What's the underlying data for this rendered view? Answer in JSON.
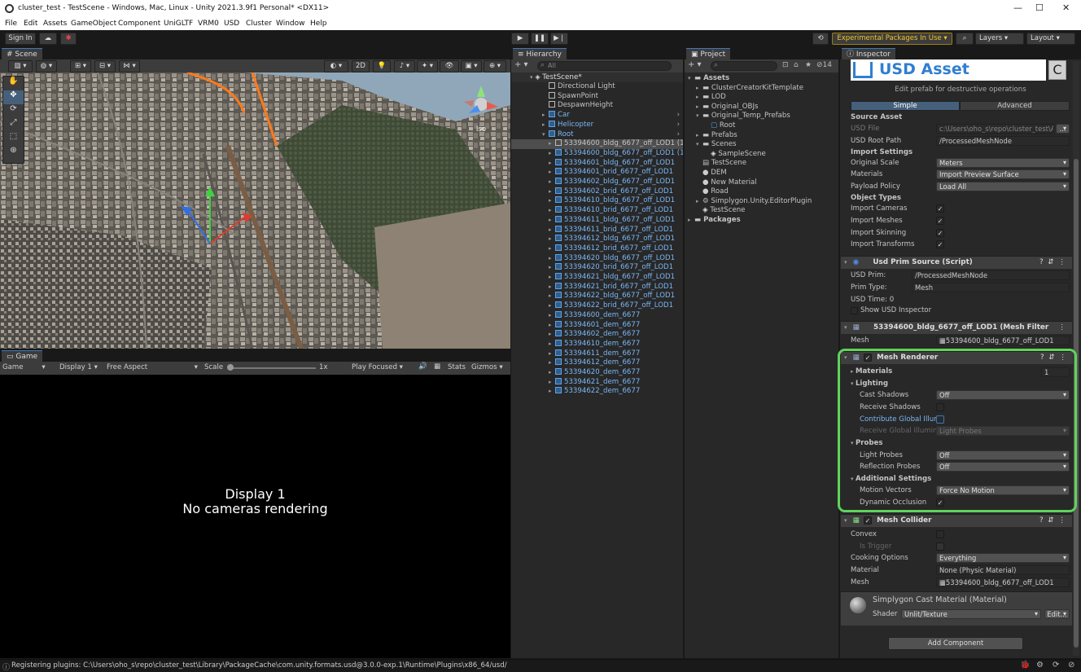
{
  "window": {
    "title": "cluster_test - TestScene - Windows, Mac, Linux - Unity 2021.3.9f1 Personal* <DX11>",
    "min": "—",
    "max": "☐",
    "close": "✕"
  },
  "menu": [
    "File",
    "Edit",
    "Assets",
    "GameObject",
    "Component",
    "UniGLTF",
    "VRM0",
    "USD",
    "Cluster",
    "Window",
    "Help"
  ],
  "toolbar": {
    "sign_in": "Sign In",
    "experimental": "Experimental Packages In Use ▾",
    "layers": "Layers",
    "layout": "Layout"
  },
  "scene": {
    "tab": "Scene",
    "mode_2d": "2D",
    "persp": "Iso"
  },
  "game": {
    "tab": "Game",
    "display_dd": "Game",
    "display": "Display 1",
    "aspect": "Free Aspect",
    "scale_label": "Scale",
    "scale_value": "1x",
    "play_focused": "Play Focused",
    "stats": "Stats",
    "gizmos": "Gizmos",
    "msg1": "Display 1",
    "msg2": "No cameras rendering"
  },
  "hierarchy": {
    "tab": "Hierarchy",
    "search": "All",
    "scene": "TestScene*",
    "items": [
      {
        "label": "Directional Light",
        "depth": 1,
        "blue": false,
        "exp": ""
      },
      {
        "label": "SpawnPoint",
        "depth": 1,
        "blue": false,
        "exp": ""
      },
      {
        "label": "DespawnHeight",
        "depth": 1,
        "blue": false,
        "exp": ""
      },
      {
        "label": "Car",
        "depth": 1,
        "blue": true,
        "exp": "▸"
      },
      {
        "label": "Helicopter",
        "depth": 1,
        "blue": true,
        "exp": "▸"
      },
      {
        "label": "Root",
        "depth": 1,
        "blue": true,
        "exp": "▾"
      },
      {
        "label": "53394600_bldg_6677_off_LOD1 (1)",
        "depth": 2,
        "blue": false,
        "exp": "▸",
        "sel": true
      },
      {
        "label": "53394600_bldg_6677_off_LOD1 (1)",
        "depth": 2,
        "blue": true,
        "exp": "▸"
      },
      {
        "label": "53394601_bldg_6677_off_LOD1",
        "depth": 2,
        "blue": true,
        "exp": "▸"
      },
      {
        "label": "53394601_brid_6677_off_LOD1",
        "depth": 2,
        "blue": true,
        "exp": "▸"
      },
      {
        "label": "53394602_bldg_6677_off_LOD1",
        "depth": 2,
        "blue": true,
        "exp": "▸"
      },
      {
        "label": "53394602_brid_6677_off_LOD1",
        "depth": 2,
        "blue": true,
        "exp": "▸"
      },
      {
        "label": "53394610_bldg_6677_off_LOD1",
        "depth": 2,
        "blue": true,
        "exp": "▸"
      },
      {
        "label": "53394610_brid_6677_off_LOD1",
        "depth": 2,
        "blue": true,
        "exp": "▸"
      },
      {
        "label": "53394611_bldg_6677_off_LOD1",
        "depth": 2,
        "blue": true,
        "exp": "▸"
      },
      {
        "label": "53394611_brid_6677_off_LOD1",
        "depth": 2,
        "blue": true,
        "exp": "▸"
      },
      {
        "label": "53394612_bldg_6677_off_LOD1",
        "depth": 2,
        "blue": true,
        "exp": "▸"
      },
      {
        "label": "53394612_brid_6677_off_LOD1",
        "depth": 2,
        "blue": true,
        "exp": "▸"
      },
      {
        "label": "53394620_bldg_6677_off_LOD1",
        "depth": 2,
        "blue": true,
        "exp": "▸"
      },
      {
        "label": "53394620_brid_6677_off_LOD1",
        "depth": 2,
        "blue": true,
        "exp": "▸"
      },
      {
        "label": "53394621_bldg_6677_off_LOD1",
        "depth": 2,
        "blue": true,
        "exp": "▸"
      },
      {
        "label": "53394621_brid_6677_off_LOD1",
        "depth": 2,
        "blue": true,
        "exp": "▸"
      },
      {
        "label": "53394622_bldg_6677_off_LOD1",
        "depth": 2,
        "blue": true,
        "exp": "▸"
      },
      {
        "label": "53394622_brid_6677_off_LOD1",
        "depth": 2,
        "blue": true,
        "exp": "▸"
      },
      {
        "label": "53394600_dem_6677",
        "depth": 2,
        "blue": true,
        "exp": "▸"
      },
      {
        "label": "53394601_dem_6677",
        "depth": 2,
        "blue": true,
        "exp": "▸"
      },
      {
        "label": "53394602_dem_6677",
        "depth": 2,
        "blue": true,
        "exp": "▸"
      },
      {
        "label": "53394610_dem_6677",
        "depth": 2,
        "blue": true,
        "exp": "▸"
      },
      {
        "label": "53394611_dem_6677",
        "depth": 2,
        "blue": true,
        "exp": "▸"
      },
      {
        "label": "53394612_dem_6677",
        "depth": 2,
        "blue": true,
        "exp": "▸"
      },
      {
        "label": "53394620_dem_6677",
        "depth": 2,
        "blue": true,
        "exp": "▸"
      },
      {
        "label": "53394621_dem_6677",
        "depth": 2,
        "blue": true,
        "exp": "▸"
      },
      {
        "label": "53394622_dem_6677",
        "depth": 2,
        "blue": true,
        "exp": "▸"
      }
    ]
  },
  "project": {
    "tab": "Project",
    "count": "14",
    "items": [
      {
        "label": "Assets",
        "depth": 0,
        "exp": "▾",
        "icon": "folder",
        "bold": true
      },
      {
        "label": "ClusterCreatorKitTemplate",
        "depth": 1,
        "exp": "▸",
        "icon": "folder"
      },
      {
        "label": "LOD",
        "depth": 1,
        "exp": "▸",
        "icon": "folder"
      },
      {
        "label": "Original_OBJs",
        "depth": 1,
        "exp": "▸",
        "icon": "folder"
      },
      {
        "label": "Original_Temp_Prefabs",
        "depth": 1,
        "exp": "▾",
        "icon": "folder"
      },
      {
        "label": "Root",
        "depth": 2,
        "exp": "",
        "icon": "cube"
      },
      {
        "label": "Prefabs",
        "depth": 1,
        "exp": "▸",
        "icon": "folder"
      },
      {
        "label": "Scenes",
        "depth": 1,
        "exp": "▾",
        "icon": "folder"
      },
      {
        "label": "SampleScene",
        "depth": 2,
        "exp": "",
        "icon": "unity"
      },
      {
        "label": "TestScene",
        "depth": 1,
        "exp": "",
        "icon": "file"
      },
      {
        "label": "DEM",
        "depth": 1,
        "exp": "",
        "icon": "sphere"
      },
      {
        "label": "New Material",
        "depth": 1,
        "exp": "",
        "icon": "sphere"
      },
      {
        "label": "Road",
        "depth": 1,
        "exp": "",
        "icon": "sphere"
      },
      {
        "label": "Simplygon.Unity.EditorPlugin",
        "depth": 1,
        "exp": "▸",
        "icon": "asm"
      },
      {
        "label": "TestScene",
        "depth": 1,
        "exp": "",
        "icon": "unity"
      },
      {
        "label": "Packages",
        "depth": 0,
        "exp": "▸",
        "icon": "folder",
        "bold": true
      }
    ]
  },
  "inspector": {
    "tab": "Inspector",
    "usd_title": "USD Asset",
    "subtitle": "Edit prefab for destructive operations",
    "tab_simple": "Simple",
    "tab_advanced": "Advanced",
    "source_asset": "Source Asset",
    "usd_file_label": "USD File",
    "usd_file": "c:\\Users\\oho_s\\repo\\cluster_test\\As",
    "usd_root_label": "USD Root Path",
    "usd_root": "/ProcessedMeshNode",
    "import_settings": "Import Settings",
    "orig_scale_label": "Original Scale",
    "orig_scale": "Meters",
    "materials_label": "Materials",
    "materials": "Import Preview Surface",
    "payload_label": "Payload Policy",
    "payload": "Load All",
    "object_types": "Object Types",
    "imp_cameras": "Import Cameras",
    "imp_meshes": "Import Meshes",
    "imp_skinning": "Import Skinning",
    "imp_transforms": "Import Transforms",
    "prim_source": {
      "title": "Usd Prim Source (Script)",
      "prim_label": "USD Prim:",
      "prim": "/ProcessedMeshNode",
      "type_label": "Prim Type:",
      "type": "Mesh",
      "time": "USD Time: 0",
      "show": "Show USD Inspector"
    },
    "mesh_filter": {
      "title": "53394600_bldg_6677_off_LOD1 (Mesh Filter",
      "mesh_label": "Mesh",
      "mesh": "53394600_bldg_6677_off_LOD1"
    },
    "mesh_renderer": {
      "title": "Mesh Renderer",
      "materials": "Materials",
      "materials_count": "1",
      "lighting": "Lighting",
      "cast_label": "Cast Shadows",
      "cast": "Off",
      "receive_label": "Receive Shadows",
      "contrib_label": "Contribute Global Illum",
      "receive_gi_label": "Receive Global Illumina",
      "receive_gi": "Light Probes",
      "probes": "Probes",
      "light_probes_label": "Light Probes",
      "light_probes": "Off",
      "refl_label": "Reflection Probes",
      "refl": "Off",
      "additional": "Additional Settings",
      "motion_label": "Motion Vectors",
      "motion": "Force No Motion",
      "occl_label": "Dynamic Occlusion"
    },
    "mesh_collider": {
      "title": "Mesh Collider",
      "convex": "Convex",
      "trigger": "Is Trigger",
      "cooking_label": "Cooking Options",
      "cooking": "Everything",
      "material_label": "Material",
      "material": "None (Physic Material)",
      "mesh_label": "Mesh",
      "mesh": "53394600_bldg_6677_off_LOD1"
    },
    "material": {
      "title": "Simplygon Cast Material (Material)",
      "shader_label": "Shader",
      "shader": "Unlit/Texture",
      "edit": "Edit..."
    },
    "add_component": "Add Component"
  },
  "status": "Registering plugins: C:\\Users\\oho_s\\repo\\cluster_test\\Library\\PackageCache\\com.unity.formats.usd@3.0.0-exp.1\\Runtime\\Plugins\\x86_64/usd/",
  "colors": {
    "highlight": "#5fd35a",
    "accent": "#3a79bb",
    "usd_blue": "#2f7fd1"
  }
}
